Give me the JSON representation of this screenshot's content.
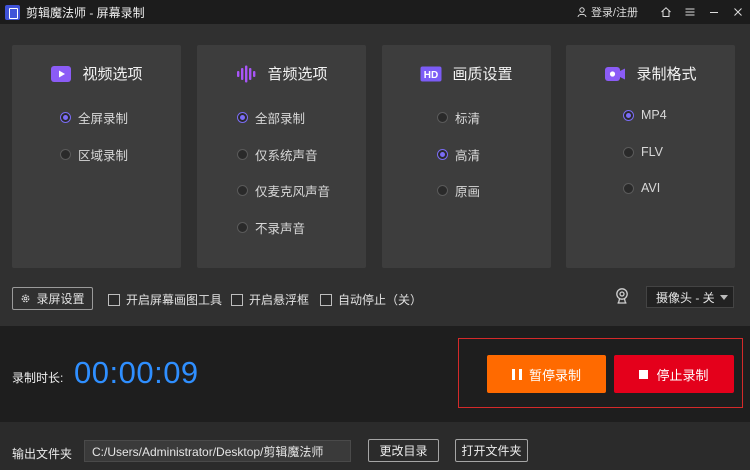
{
  "app": {
    "title": "剪辑魔法师 - 屏幕录制"
  },
  "titlebar": {
    "login_label": "登录/注册"
  },
  "cards": [
    {
      "title": "视频选项",
      "icon": "video-icon",
      "color": "#8b5cf6",
      "options": [
        {
          "label": "全屏录制",
          "selected": true
        },
        {
          "label": "区域录制",
          "selected": false
        }
      ]
    },
    {
      "title": "音频选项",
      "icon": "audio-wave-icon",
      "color": "#a855f7",
      "options": [
        {
          "label": "全部录制",
          "selected": true
        },
        {
          "label": "仅系统声音",
          "selected": false
        },
        {
          "label": "仅麦克风声音",
          "selected": false
        },
        {
          "label": "不录声音",
          "selected": false
        }
      ]
    },
    {
      "title": "画质设置",
      "icon": "hd-icon",
      "color": "#7c5cf6",
      "options": [
        {
          "label": "标清",
          "selected": false
        },
        {
          "label": "高清",
          "selected": true
        },
        {
          "label": "原画",
          "selected": false
        }
      ]
    },
    {
      "title": "录制格式",
      "icon": "record-format-icon",
      "color": "#8b5cf6",
      "options": [
        {
          "label": "MP4",
          "selected": true
        },
        {
          "label": "FLV",
          "selected": false
        },
        {
          "label": "AVI",
          "selected": false
        }
      ]
    }
  ],
  "options_bar": {
    "settings_label": "录屏设置",
    "checkbox_screen_draw": "开启屏幕画图工具",
    "checkbox_float": "开启悬浮框",
    "checkbox_autostop": "自动停止（关）",
    "camera_value": "摄像头 - 关"
  },
  "recording": {
    "duration_label": "录制时长:",
    "timer": "00:00:09",
    "pause_label": "暂停录制",
    "stop_label": "停止录制"
  },
  "output": {
    "folder_label": "输出文件夹",
    "path": "C:/Users/Administrator/Desktop/剪辑魔法师",
    "change_dir_label": "更改目录",
    "open_folder_label": "打开文件夹"
  },
  "colors": {
    "accent": "#7a6cf5",
    "timer": "#2f8fff",
    "pause": "#ff6a00",
    "stop": "#e4001b",
    "frame": "#d42a2a"
  }
}
